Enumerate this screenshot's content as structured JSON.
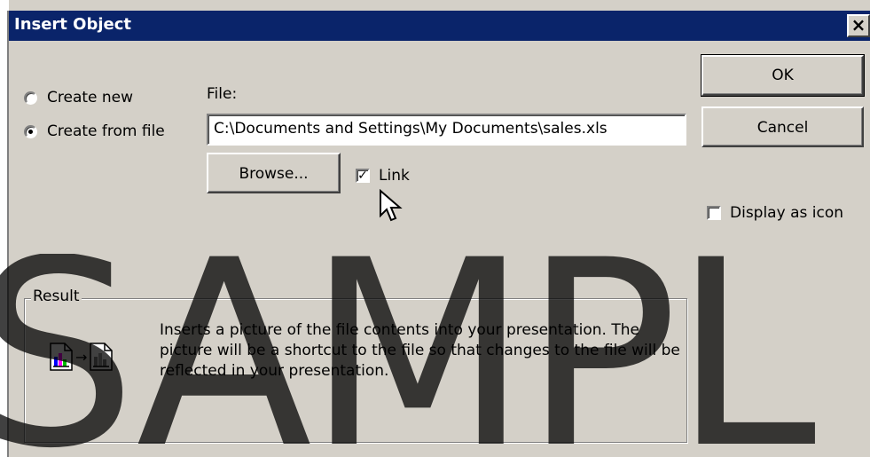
{
  "window": {
    "title": "Insert Object",
    "close_glyph": "✕"
  },
  "options": {
    "create_new": "Create new",
    "create_from_file": "Create from file",
    "selected": "create_from_file"
  },
  "file": {
    "label": "File:",
    "value": "C:\\Documents and Settings\\My Documents\\sales.xls",
    "browse_label": "Browse...",
    "link_label": "Link",
    "link_checked": true
  },
  "buttons": {
    "ok": "OK",
    "cancel": "Cancel"
  },
  "display_as_icon": {
    "label": "Display as icon",
    "checked": false
  },
  "result": {
    "legend": "Result",
    "text": "Inserts a picture of the file contents into your presentation. The picture will be a shortcut to the file so that changes to the file will be reflected in your presentation.",
    "icons": [
      "document-chart-icon",
      "arrow-icon",
      "document-picture-icon"
    ]
  },
  "watermark": "SAMPL",
  "colors": {
    "titlebar": "#0a246a",
    "dialog_face": "#d4d0c8",
    "title_text": "#ffffff"
  }
}
